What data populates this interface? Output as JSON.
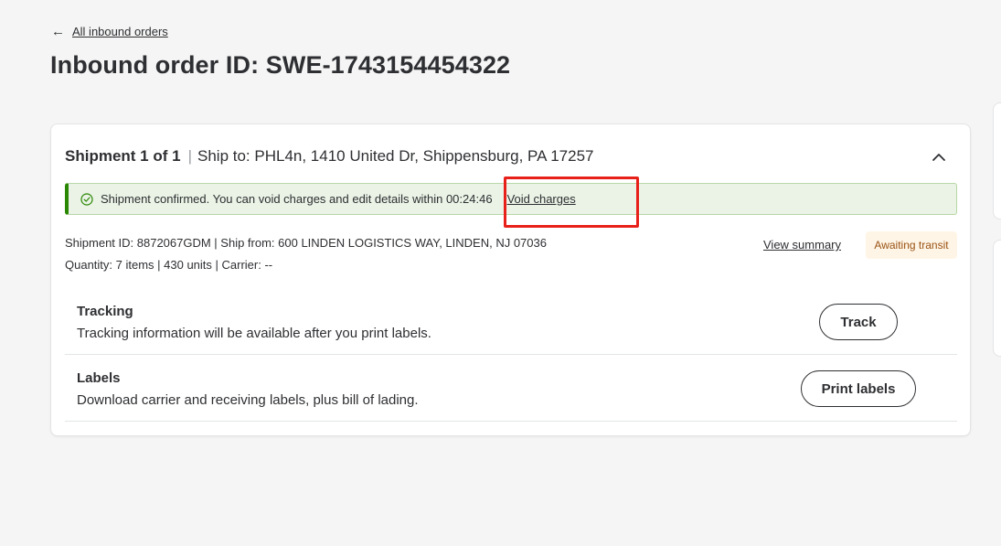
{
  "nav": {
    "back_arrow": "←",
    "back_label": "All inbound orders"
  },
  "page": {
    "title": "Inbound order ID: SWE-1743154454322"
  },
  "shipment": {
    "heading": "Shipment 1 of 1",
    "separator": "|",
    "ship_to": "Ship to: PHL4n, 1410 United Dr, Shippensburg, PA 17257",
    "banner": {
      "message": "Shipment confirmed. You can void charges and edit details within 00:24:46",
      "void_label": "Void charges"
    },
    "details_line1": "Shipment ID: 8872067GDM | Ship from: 600 LINDEN LOGISTICS WAY, LINDEN, NJ 07036",
    "details_line2": "Quantity: 7 items | 430 units | Carrier: --",
    "view_summary_label": "View summary",
    "status": "Awaiting transit"
  },
  "tracking": {
    "title": "Tracking",
    "description": "Tracking information will be available after you print labels.",
    "button_label": "Track"
  },
  "labels": {
    "title": "Labels",
    "description": "Download carrier and receiving labels, plus bill of lading.",
    "button_label": "Print labels"
  },
  "colors": {
    "success_green": "#2a8703",
    "banner_bg": "#eaf3e6",
    "status_bg": "#fff5e6",
    "status_text": "#995213",
    "highlight_red": "#e8201a"
  },
  "icons": {
    "back": "arrow-left-icon",
    "collapse": "chevron-up-icon",
    "banner": "check-circle-icon"
  }
}
